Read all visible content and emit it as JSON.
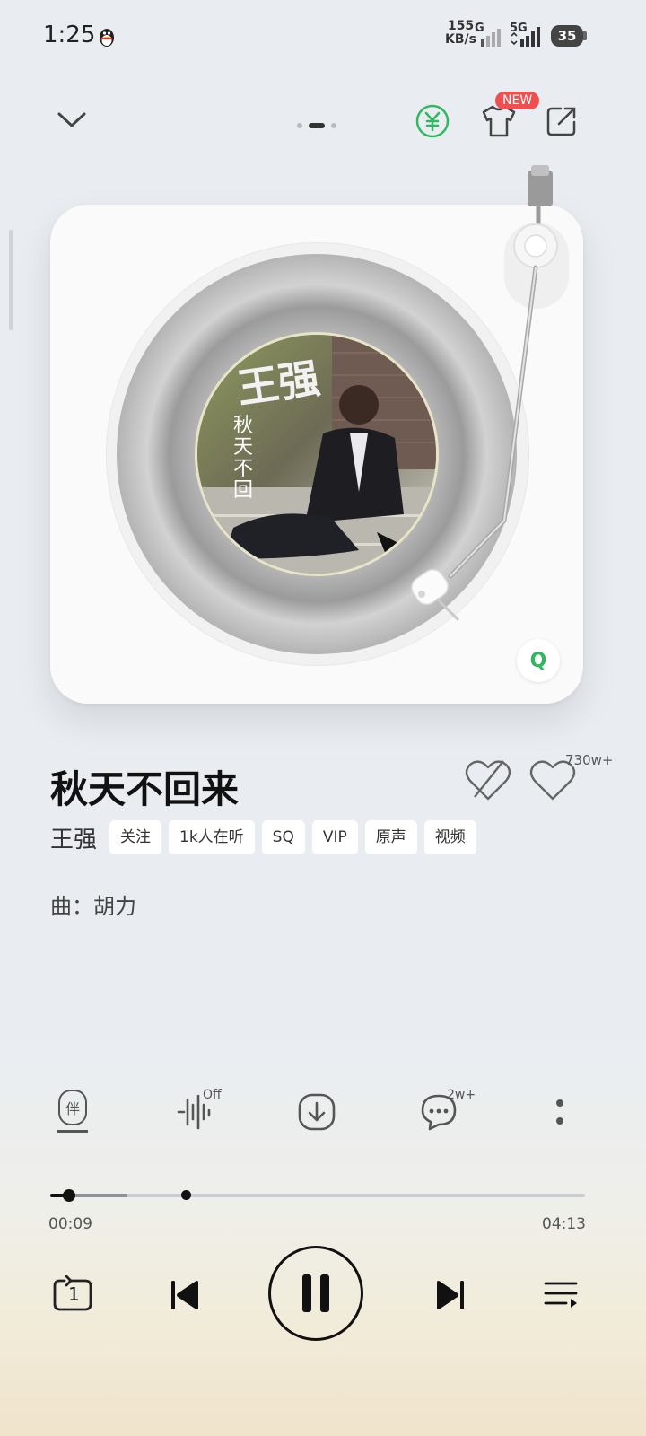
{
  "status_bar": {
    "time": "1:25",
    "net_speed_value": "155",
    "net_speed_unit": "KB/s",
    "sim1_label": "G",
    "sim2_label": "5G",
    "battery": "35"
  },
  "top_bar": {
    "new_badge": "NEW",
    "page_indicator_active": 1,
    "page_indicator_count": 3
  },
  "song": {
    "title": "秋天不回来",
    "artist": "王强",
    "tags": [
      "关注",
      "1k人在听",
      "SQ",
      "VIP",
      "原声",
      "视频"
    ],
    "composer": "曲：胡力",
    "like_count": "730w+"
  },
  "album_art": {
    "text_large": "王强",
    "text_small": "秋天不回"
  },
  "actions": {
    "accompany_label": "伴",
    "sound_effect_state": "Off",
    "comment_count": "2w+"
  },
  "playback": {
    "current_time": "00:09",
    "total_time": "04:13",
    "progress": 0.036,
    "repeat_mode_label": "1"
  },
  "colors": {
    "accent_green": "#2fb85f",
    "badge_red": "#ef4f4f"
  }
}
